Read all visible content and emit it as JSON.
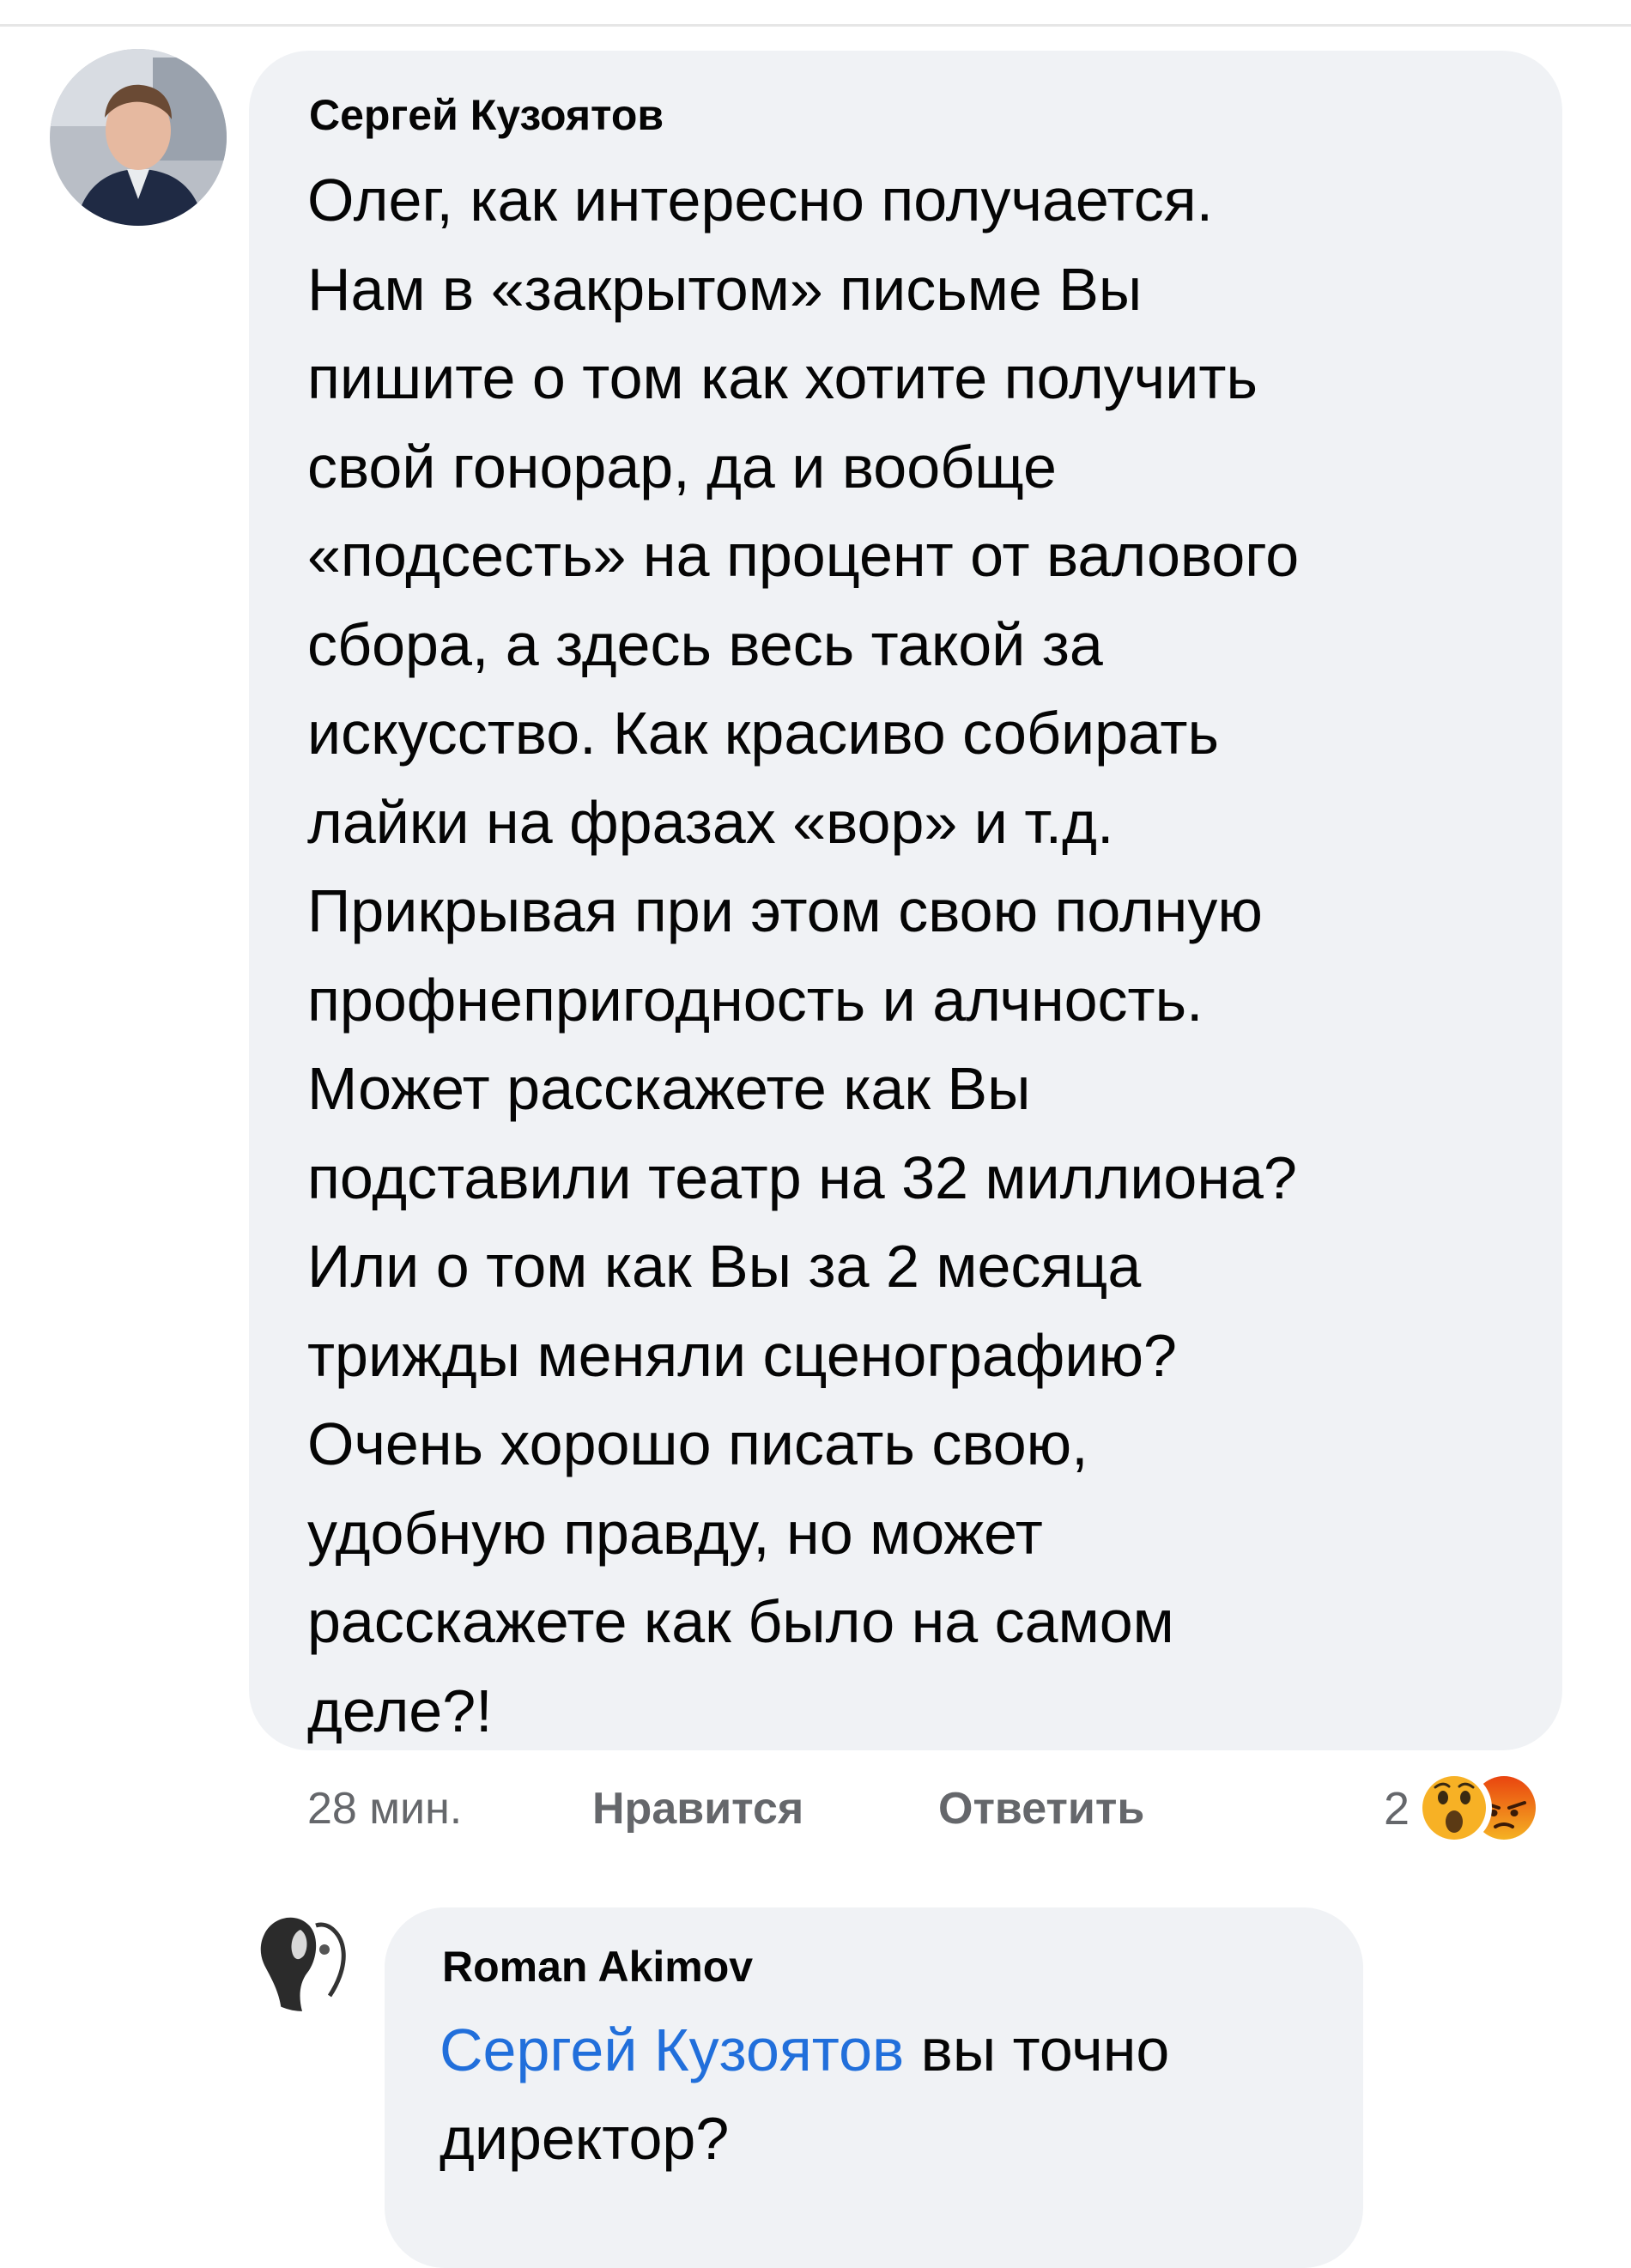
{
  "comment": {
    "author": "Сергей Кузоятов",
    "lines": [
      "Олег, как интересно получается.",
      "Нам в «закрытом» письме Вы",
      "пишите о том как хотите получить",
      "свой гонорар, да и вообще",
      "«подсесть» на процент от валового",
      "сбора, а здесь весь такой за",
      "искусство. Как красиво собирать",
      "лайки на фразах «вор» и т.д.",
      "Прикрывая при этом свою полную",
      "профнепригодность и алчность.",
      "Может расскажете как Вы",
      "подставили театр на 32 миллиона?",
      "Или о том как Вы за 2 месяца",
      "трижды меняли сценографию?",
      "Очень хорошо писать свою,",
      "удобную правду, но может",
      "расскажете как было на самом",
      "деле?!"
    ],
    "time": "28 мин.",
    "like_label": "Нравится",
    "reply_label": "Ответить",
    "reaction_count": "2",
    "reactions": [
      "wow-icon",
      "angry-icon"
    ]
  },
  "reply": {
    "author": "Roman Akimov",
    "mention": "Сергей Кузоятов",
    "text_line1": " вы точно",
    "text_line2": "директор?"
  },
  "colors": {
    "bubble": "#f0f2f5",
    "text": "#050505",
    "secondary": "#65676b",
    "mention": "#216fdb",
    "wow": "#f7b125",
    "angry": "#e9710f"
  }
}
